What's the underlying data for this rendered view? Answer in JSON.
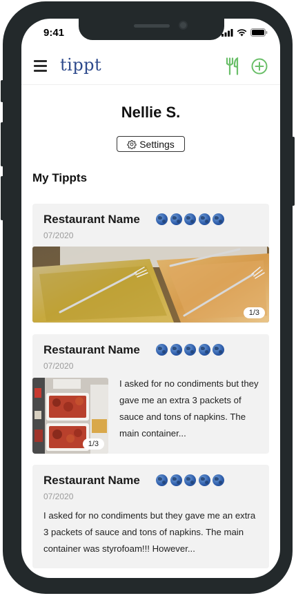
{
  "status": {
    "time": "9:41"
  },
  "header": {
    "brand": "tippt"
  },
  "profile": {
    "name": "Nellie S.",
    "settings_label": "Settings"
  },
  "section": {
    "title": "My Tippts"
  },
  "cards": [
    {
      "title": "Restaurant Name",
      "rating": 5,
      "date": "07/2020",
      "photo_counter": "1/3",
      "text": ""
    },
    {
      "title": "Restaurant Name",
      "rating": 5,
      "date": "07/2020",
      "photo_counter": "1/3",
      "text": "I asked for no condiments but they gave me an extra 3 packets of sauce and tons of napkins. The main container..."
    },
    {
      "title": "Restaurant Name",
      "rating": 5,
      "date": "07/2020",
      "text": "I asked for no condiments but they gave me an extra 3 packets of sauce and tons of napkins. The main container was styrofoam!!! However..."
    }
  ],
  "colors": {
    "brand": "#2e4a8c",
    "accent_green": "#6abf69",
    "card_bg": "#f2f2f2",
    "frame": "#23292b"
  }
}
